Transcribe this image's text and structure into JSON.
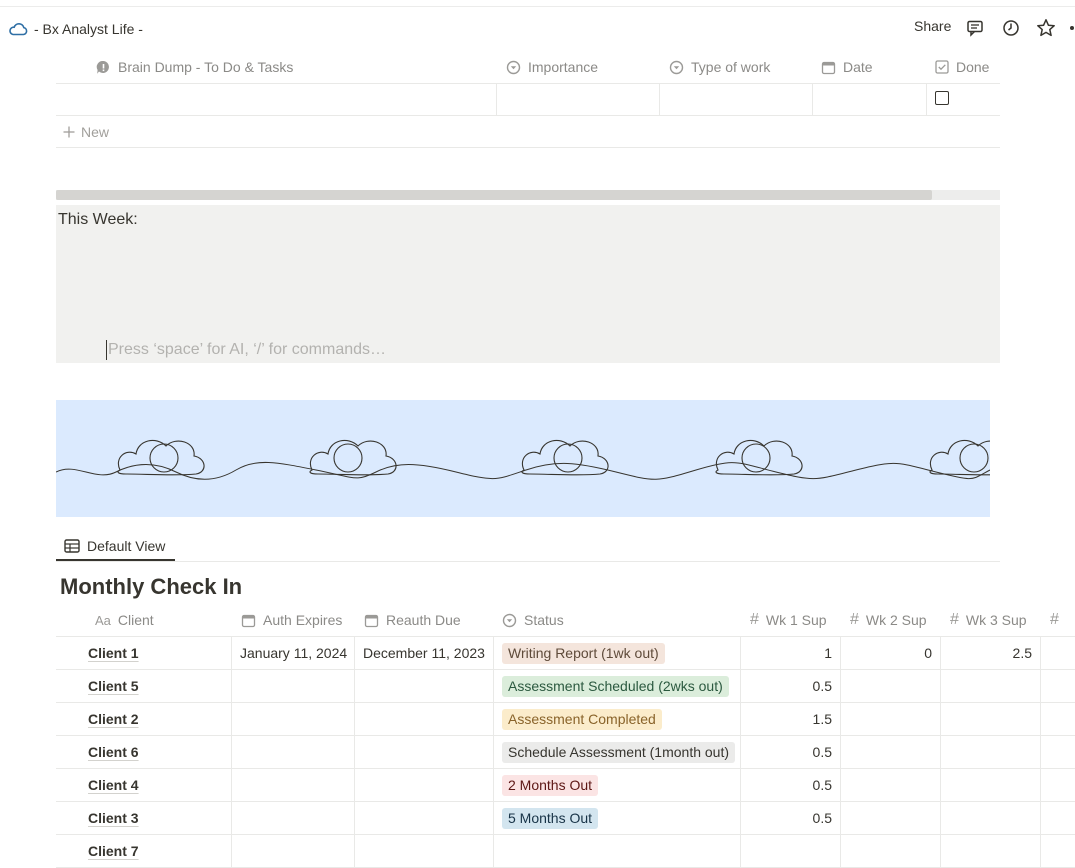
{
  "topbar": {
    "breadcrumb": "- Bx Analyst Life -",
    "share_label": "Share"
  },
  "tasks_table": {
    "columns": [
      "Brain Dump - To Do & Tasks",
      "Importance",
      "Type of work",
      "Date",
      "Done"
    ],
    "new_label": "New"
  },
  "callout": {
    "title": "This Week:",
    "placeholder": "Press ‘space’ for AI, ‘/’ for commands…"
  },
  "view": {
    "tab_label": "Default View",
    "title": "Monthly Check In"
  },
  "checkin_table": {
    "columns": [
      "Client",
      "Auth Expires",
      "Reauth Due",
      "Status",
      "Wk 1 Sup",
      "Wk 2 Sup",
      "Wk 3 Sup"
    ],
    "rows": [
      {
        "client": "Client 1",
        "auth": "January 11, 2024",
        "reauth": "December 11, 2023",
        "status": "Writing Report (1wk out)",
        "status_color": "brown",
        "wk1": "1",
        "wk2": "0",
        "wk3": "2.5"
      },
      {
        "client": "Client 5",
        "auth": "",
        "reauth": "",
        "status": "Assessment Scheduled (2wks out)",
        "status_color": "green",
        "wk1": "0.5",
        "wk2": "",
        "wk3": ""
      },
      {
        "client": "Client 2",
        "auth": "",
        "reauth": "",
        "status": "Assessment Completed",
        "status_color": "yellow",
        "wk1": "1.5",
        "wk2": "",
        "wk3": ""
      },
      {
        "client": "Client 6",
        "auth": "",
        "reauth": "",
        "status": "Schedule Assessment (1month out)",
        "status_color": "gray",
        "wk1": "0.5",
        "wk2": "",
        "wk3": ""
      },
      {
        "client": "Client 4",
        "auth": "",
        "reauth": "",
        "status": "2 Months Out",
        "status_color": "red",
        "wk1": "0.5",
        "wk2": "",
        "wk3": ""
      },
      {
        "client": "Client 3",
        "auth": "",
        "reauth": "",
        "status": "5 Months Out",
        "status_color": "blue",
        "wk1": "0.5",
        "wk2": "",
        "wk3": ""
      },
      {
        "client": "Client 7",
        "auth": "",
        "reauth": "",
        "status": "",
        "status_color": "",
        "wk1": "",
        "wk2": "",
        "wk3": ""
      }
    ]
  },
  "tag_colors": {
    "brown": {
      "bg": "#f4e5dc",
      "fg": "#5f4b3a"
    },
    "green": {
      "bg": "#dbeddb",
      "fg": "#2b593f"
    },
    "yellow": {
      "bg": "#fbeccb",
      "fg": "#89632a"
    },
    "gray": {
      "bg": "#ebebea",
      "fg": "#37352f"
    },
    "red": {
      "bg": "#fbe4e4",
      "fg": "#5d1715"
    },
    "blue": {
      "bg": "#d3e5ef",
      "fg": "#183347"
    }
  },
  "colors": {
    "callout_bg": "#f1f1ef",
    "cover_bg": "#dbeafe",
    "text": "#37352f",
    "muted": "#8b8a87"
  }
}
